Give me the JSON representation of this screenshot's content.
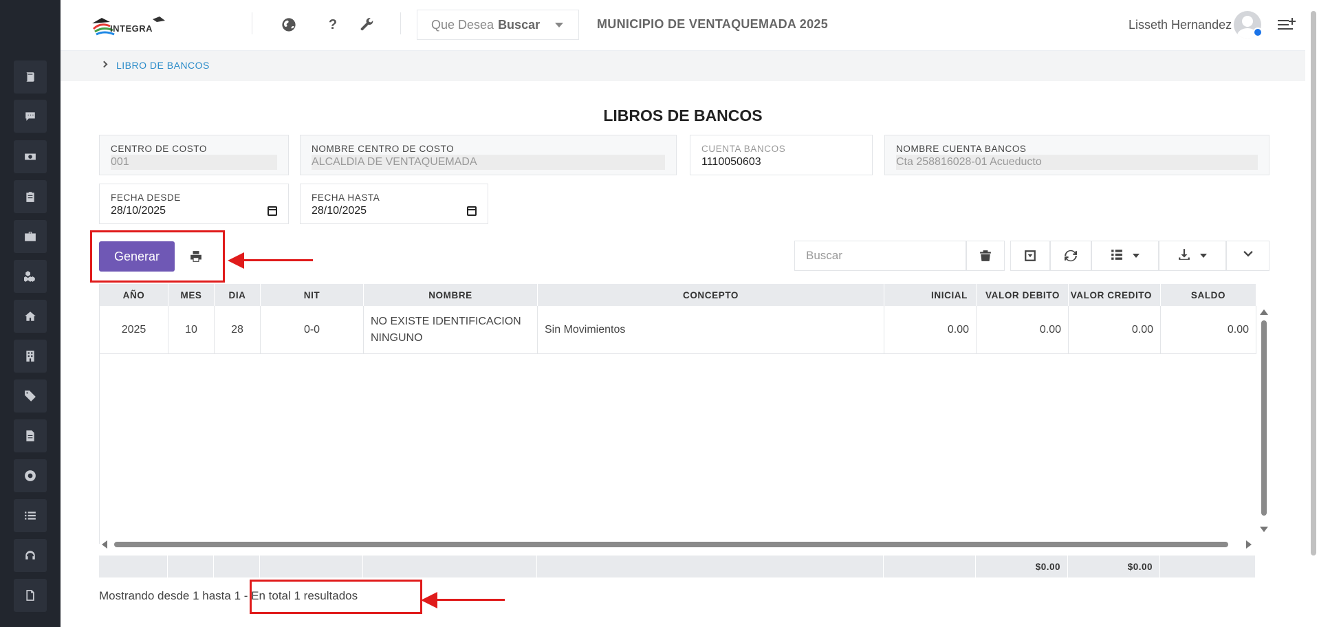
{
  "header": {
    "logo_text": "INTEGRA",
    "search_placeholder_prefix": "Que Desea",
    "search_placeholder_bold": "Buscar",
    "municipality": "MUNICIPIO DE VENTAQUEMADA 2025",
    "user_name": "Lisseth Hernandez"
  },
  "icons": {
    "top": [
      "globe-icon",
      "help-icon",
      "wrench-icon",
      "menu-add-icon"
    ],
    "sidebar": [
      "book-icon",
      "comment-icon",
      "money-icon",
      "clipboard-icon",
      "briefcase-icon",
      "cubes-icon",
      "home-icon",
      "building-icon",
      "tags-icon",
      "file-icon",
      "lifering-icon",
      "list-icon",
      "headset-icon",
      "pdf-icon"
    ]
  },
  "breadcrumb": {
    "item": "LIBRO DE BANCOS"
  },
  "page": {
    "title": "LIBROS DE BANCOS"
  },
  "form": {
    "centro_costo": {
      "label": "CENTRO DE COSTO",
      "value": "001"
    },
    "nombre_centro": {
      "label": "NOMBRE CENTRO DE COSTO",
      "value": "ALCALDIA DE VENTAQUEMADA"
    },
    "cuenta_bancos": {
      "label": "CUENTA BANCOS",
      "value": "1110050603"
    },
    "nombre_cuenta": {
      "label": "NOMBRE CUENTA BANCOS",
      "value": "Cta 258816028-01 Acueducto"
    },
    "fecha_desde": {
      "label": "FECHA DESDE",
      "value": "28/10/2025"
    },
    "fecha_hasta": {
      "label": "FECHA HASTA",
      "value": "28/10/2025"
    }
  },
  "actions": {
    "generate_label": "Generar"
  },
  "table_toolbar": {
    "search_placeholder": "Buscar"
  },
  "table": {
    "columns": [
      "AÑO",
      "MES",
      "DIA",
      "NIT",
      "NOMBRE",
      "CONCEPTO",
      "INICIAL",
      "VALOR DEBITO",
      "VALOR CREDITO",
      "SALDO"
    ],
    "rows": [
      [
        "2025",
        "10",
        "28",
        "0-0",
        "NO EXISTE IDENTIFICACION NINGUNO",
        "Sin Movimientos",
        "0.00",
        "0.00",
        "0.00",
        "0.00"
      ]
    ],
    "footer": {
      "total_debito": "$0.00",
      "total_credito": "$0.00"
    }
  },
  "pagination": {
    "text": "Mostrando desde 1 hasta 1 - En total 1 resultados"
  },
  "colors": {
    "sidebar": "#22262e",
    "primary_button": "#6f58b5",
    "annotation": "#e01b1b",
    "link": "#2a8bc9"
  }
}
